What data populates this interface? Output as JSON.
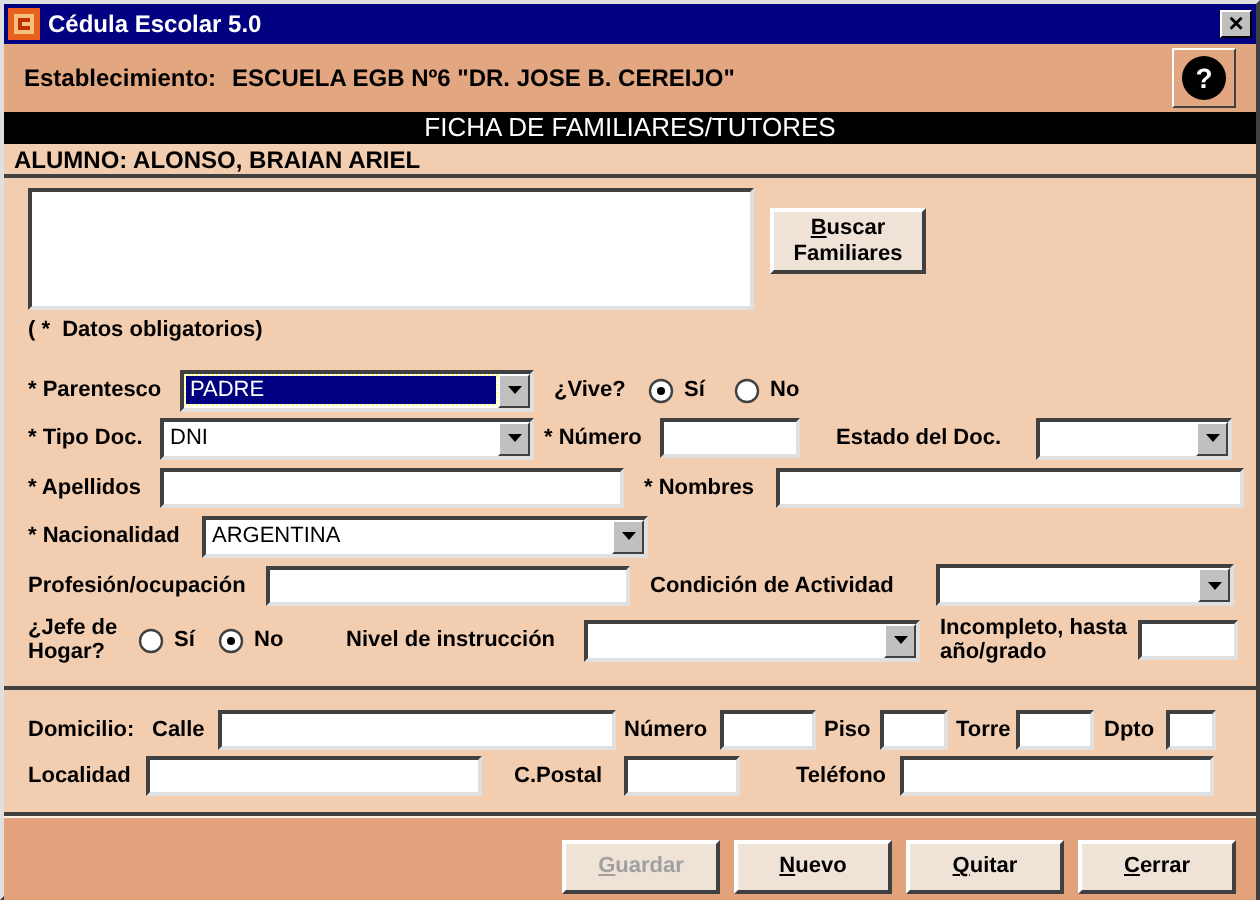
{
  "window": {
    "title": "Cédula Escolar 5.0",
    "close": "×"
  },
  "header": {
    "label": "Establecimiento:",
    "value": "ESCUELA EGB Nº6 \"DR. JOSE B. CEREIJO\"",
    "help": "?"
  },
  "banner": "FICHA DE FAMILIARES/TUTORES",
  "student": "ALUMNO: ALONSO, BRAIAN ARIEL",
  "search_button": {
    "label": "Buscar Familiares",
    "underline_first": true
  },
  "required_note": "( *  Datos obligatorios)",
  "rows": [
    [
      {
        "kind": "label",
        "text": "* Parentesco"
      },
      {
        "kind": "combo",
        "value": "PADRE",
        "focused": true
      },
      {
        "kind": "label",
        "text": "¿Vive?"
      },
      {
        "kind": "radio",
        "label": "Sí",
        "selected": true
      },
      {
        "kind": "radio",
        "label": "No",
        "selected": false
      }
    ],
    [
      {
        "kind": "label",
        "text": "* Tipo Doc."
      },
      {
        "kind": "combo",
        "value": "DNI",
        "focused": false
      },
      {
        "kind": "label",
        "text": "* Número"
      },
      {
        "kind": "text_field"
      },
      {
        "kind": "label",
        "text": "Estado del Doc."
      },
      {
        "kind": "combo",
        "focused": false
      }
    ],
    [
      {
        "kind": "label",
        "text": "* Apellidos"
      },
      {
        "kind": "text_field"
      },
      {
        "kind": "label",
        "text": "* Nombres"
      },
      {
        "kind": "text_field"
      }
    ],
    [
      {
        "kind": "label",
        "text": "* Nacionalidad"
      },
      {
        "kind": "combo",
        "value": "ARGENTINA",
        "focused": false
      }
    ],
    [
      {
        "kind": "label",
        "text": "Profesión/ocupación"
      },
      {
        "kind": "text_field"
      },
      {
        "kind": "label",
        "text": "Condición de Actividad"
      },
      {
        "kind": "combo",
        "focused": false
      }
    ],
    [
      {
        "kind": "label",
        "text": "¿Jefe de Hogar?"
      },
      {
        "kind": "radio",
        "label": "Sí",
        "selected": false
      },
      {
        "kind": "radio",
        "label": "No",
        "selected": true
      },
      {
        "kind": "label",
        "text": "Nivel de instrucción"
      },
      {
        "kind": "combo",
        "focused": false
      },
      {
        "kind": "label",
        "text": "Incompleto, hasta año/grado"
      },
      {
        "kind": "text_field"
      }
    ],
    [
      {
        "kind": "label",
        "text": "Domicilio:"
      },
      {
        "kind": "label",
        "text": "Calle"
      },
      {
        "kind": "text_field"
      },
      {
        "kind": "label",
        "text": "Número"
      },
      {
        "kind": "text_field"
      },
      {
        "kind": "label",
        "text": "Piso"
      },
      {
        "kind": "text_field"
      },
      {
        "kind": "label",
        "text": "Torre"
      },
      {
        "kind": "text_field"
      },
      {
        "kind": "label",
        "text": "Dpto"
      },
      {
        "kind": "text_field"
      }
    ],
    [
      {
        "kind": "label",
        "text": "Localidad"
      },
      {
        "kind": "text_field"
      },
      {
        "kind": "label",
        "text": "C.Postal"
      },
      {
        "kind": "text_field"
      },
      {
        "kind": "label",
        "text": "Teléfono"
      },
      {
        "kind": "text_field"
      }
    ]
  ],
  "buttons": [
    {
      "label": "Guardar",
      "disabled": true,
      "underline_first": true
    },
    {
      "label": "Nuevo",
      "disabled": false,
      "underline_first": true
    },
    {
      "label": "Quitar",
      "disabled": false,
      "underline_first": true
    },
    {
      "label": "Cerrar",
      "disabled": false,
      "underline_first": true
    }
  ]
}
